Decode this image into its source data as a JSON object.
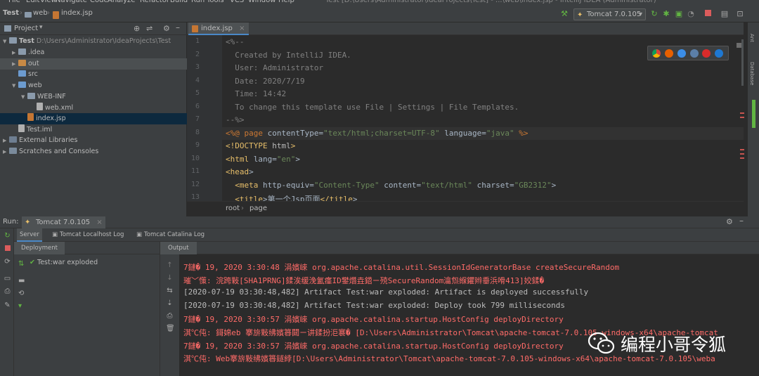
{
  "menu": [
    "File",
    "Edit",
    "View",
    "Navigate",
    "Code",
    "Analyze",
    "Refactor",
    "Build",
    "Run",
    "Tools",
    "VCS",
    "Window",
    "Help"
  ],
  "window_title": "Test [D:\\Users\\Administrator\\IdeaProjects\\Test] - ...\\web\\index.jsp - IntelliJ IDEA (Administrator)",
  "nav": {
    "project": "Test",
    "folder": "web",
    "file": "index.jsp"
  },
  "run_config": "Tomcat 7.0.105",
  "project_panel": {
    "title": "Project",
    "items": [
      {
        "label": "Test",
        "extra": "D:\\Users\\Administrator\\IdeaProjects\\Test",
        "depth": 0,
        "kind": "project"
      },
      {
        "label": ".idea",
        "depth": 1,
        "kind": "folder"
      },
      {
        "label": "out",
        "depth": 1,
        "kind": "folder-orange"
      },
      {
        "label": "src",
        "depth": 1,
        "kind": "folder-blue"
      },
      {
        "label": "web",
        "depth": 1,
        "kind": "folder-blue"
      },
      {
        "label": "WEB-INF",
        "depth": 2,
        "kind": "folder"
      },
      {
        "label": "web.xml",
        "depth": 3,
        "kind": "file"
      },
      {
        "label": "index.jsp",
        "depth": 2,
        "kind": "file-jsp"
      },
      {
        "label": "Test.iml",
        "depth": 1,
        "kind": "file"
      },
      {
        "label": "External Libraries",
        "depth": 0,
        "kind": "lib"
      },
      {
        "label": "Scratches and Consoles",
        "depth": 0,
        "kind": "scratch"
      }
    ]
  },
  "editor": {
    "tab": "index.jsp",
    "line_numbers": [
      "1",
      "2",
      "3",
      "4",
      "5",
      "6",
      "7",
      "8",
      "9",
      "10",
      "11",
      "12",
      "13"
    ],
    "lines": [
      "<%--",
      "  Created by IntelliJ IDEA.",
      "  User: Administrator",
      "  Date: 2020/7/19",
      "  Time: 14:42",
      "  To change this template use File | Settings | File Templates.",
      "--%>",
      "<%@ page contentType=\"text/html;charset=UTF-8\" language=\"java\" %>",
      "<!DOCTYPE html>",
      "<html lang=\"en\">",
      "<head>",
      "  <meta http-equiv=\"Content-Type\" content=\"text/html\" charset=\"GB2312\">",
      "  <title>第一个Jsp页面</title>"
    ],
    "breadcrumb": [
      "root",
      "page"
    ]
  },
  "right_strip": [
    "Ant",
    "Database"
  ],
  "run_panel": {
    "label": "Run:",
    "config_tab": "Tomcat 7.0.105",
    "subtabs": [
      "Server",
      "Tomcat Localhost Log",
      "Tomcat Catalina Log"
    ],
    "deployment_header": "Deployment",
    "output_header": "Output",
    "deployment_item": "Test:war exploded",
    "output_lines": [
      {
        "text": "7鏈� 19, 2020 3:30:48 涓嬪崍 org.apache.catalina.util.SessionIdGeneratorBase createSecureRandom",
        "kind": "err"
      },
      {
        "text": "璀﹀憡: 浣跨敤[SHA1PRNG]鍒涘缓浼氳瘽ID鐢熸垚鍣ㄧ殑SecureRandom瀹炰緥鑺辫垂浜嗗413]姣鍒�",
        "kind": "err"
      },
      {
        "text": "[2020-07-19 03:30:48,482] Artifact Test:war exploded: Artifact is deployed successfully",
        "kind": "info"
      },
      {
        "text": "[2020-07-19 03:30:48,482] Artifact Test:war exploded: Deploy took 799 milliseconds",
        "kind": "info"
      },
      {
        "text": "7鏈� 19, 2020 3:30:57 涓嬪崍 org.apache.catalina.startup.HostConfig deployDirectory",
        "kind": "err"
      },
      {
        "text": "淇℃伅: 鎶婂eb 搴旂敤绋嬪簭閮ㄧ讲鍒扮洰褰� [D:\\Users\\Administrator\\Tomcat\\apache-tomcat-7.0.105-windows-x64\\apache-tomcat",
        "kind": "err"
      },
      {
        "text": "7鏈� 19, 2020 3:30:57 涓嬪崍 org.apache.catalina.startup.HostConfig deployDirectory",
        "kind": "err"
      },
      {
        "text": "淇℃伅: Web搴旂敤绋嬪簭鐩綍[D:\\Users\\Administrator\\Tomcat\\apache-tomcat-7.0.105-windows-x64\\apache-tomcat-7.0.105\\weba",
        "kind": "err"
      }
    ]
  },
  "watermark": "编程小哥令狐",
  "colors": {
    "accent": "#4a88c7",
    "error": "#ff6b68",
    "arrow": "#e8282b"
  }
}
